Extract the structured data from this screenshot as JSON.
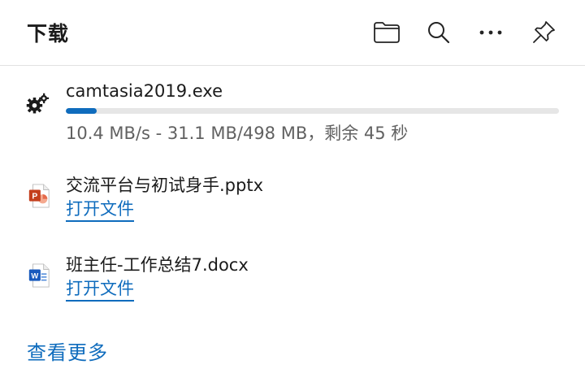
{
  "header": {
    "title": "下载",
    "buttons": [
      {
        "icon": "folder-icon"
      },
      {
        "icon": "search-icon"
      },
      {
        "icon": "more-icon"
      },
      {
        "icon": "pin-icon"
      }
    ]
  },
  "downloads": [
    {
      "file_name": "camtasia2019.exe",
      "icon": "exe-gears-icon",
      "progress": 0.0625,
      "status": "10.4 MB/s - 31.1 MB/498 MB，剩余 45 秒"
    },
    {
      "file_name": "交流平台与初试身手.pptx",
      "icon": "powerpoint-icon",
      "action_label": "打开文件"
    },
    {
      "file_name": "班主任-工作总结7.docx",
      "icon": "word-icon",
      "action_label": "打开文件"
    }
  ],
  "footer": {
    "see_more_label": "查看更多"
  },
  "colors": {
    "accent": "#0f6cbd",
    "progress_track": "#e6e6e6",
    "powerpoint": "#c43e1c",
    "word": "#185abd"
  }
}
